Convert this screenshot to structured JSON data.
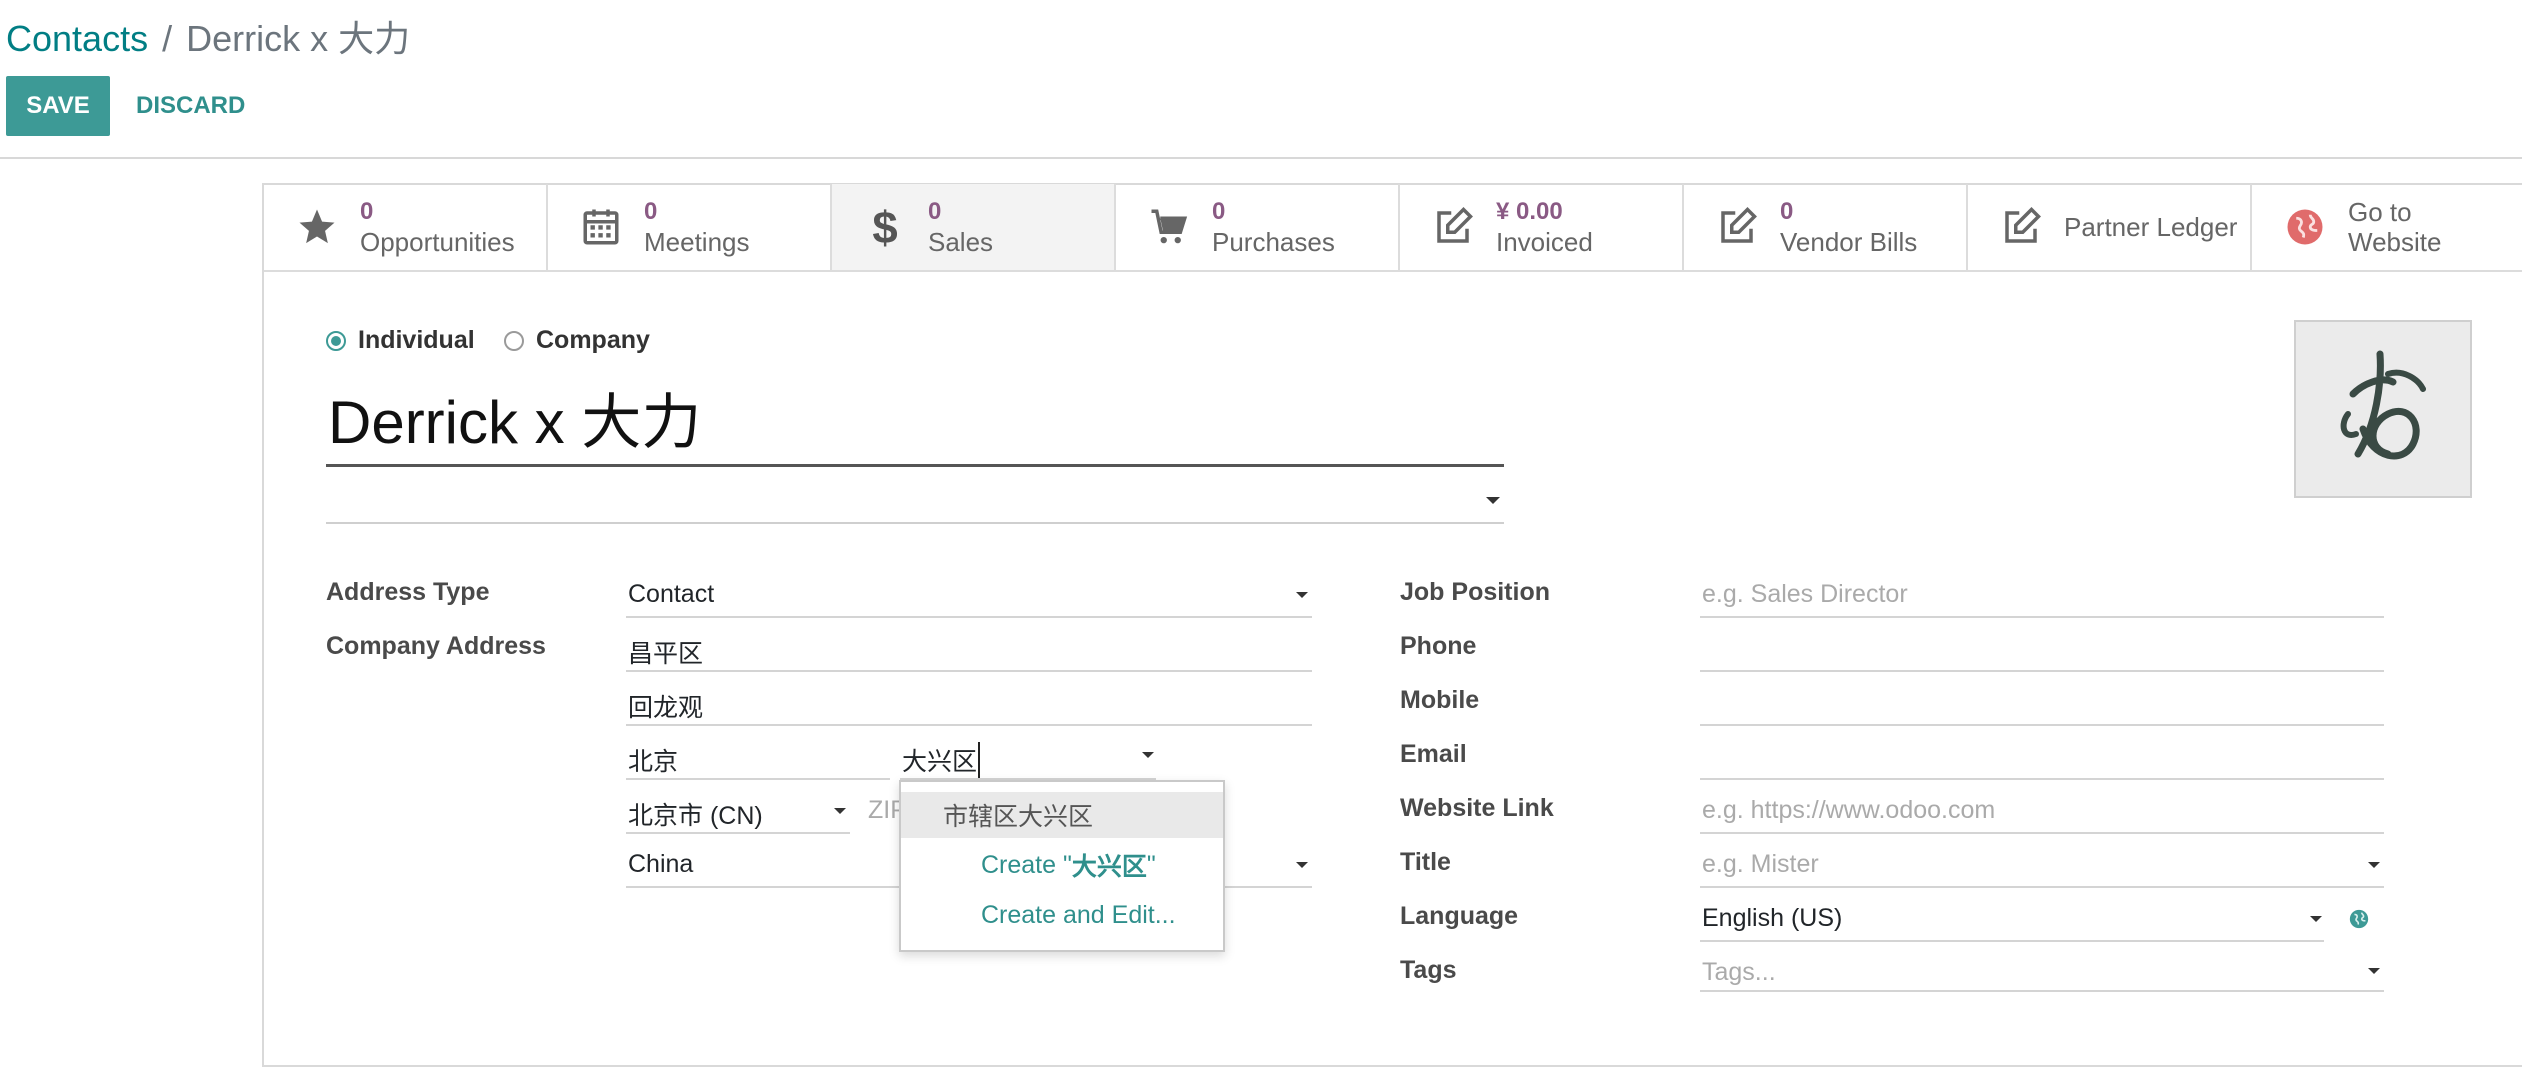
{
  "breadcrumb": {
    "root": "Contacts",
    "separator": "/",
    "current": "Derrick x 大力"
  },
  "actions": {
    "save": "SAVE",
    "discard": "DISCARD"
  },
  "smart_buttons": [
    {
      "value": "0",
      "label": "Opportunities",
      "icon": "star-icon"
    },
    {
      "value": "0",
      "label": "Meetings",
      "icon": "calendar-icon"
    },
    {
      "value": "0",
      "label": "Sales",
      "icon": "dollar-icon"
    },
    {
      "value": "0",
      "label": "Purchases",
      "icon": "cart-icon"
    },
    {
      "value": "¥ 0.00",
      "label": "Invoiced",
      "icon": "pencil-square-icon"
    },
    {
      "value": "0",
      "label": "Vendor Bills",
      "icon": "pencil-square-icon"
    },
    {
      "label": "Partner Ledger",
      "icon": "pencil-square-icon"
    },
    {
      "label": "Go to\nWebsite",
      "label_line1": "Go to",
      "label_line2": "Website",
      "icon": "globe-icon"
    }
  ],
  "company_type": {
    "individual": "Individual",
    "company": "Company",
    "selected": "individual"
  },
  "name": "Derrick x 大力",
  "left_fields": {
    "address_type_label": "Address Type",
    "address_type_value": "Contact",
    "company_address_label": "Company Address",
    "street": "昌平区",
    "street2": "回龙观",
    "city": "北京",
    "district": "大兴区",
    "state": "北京市 (CN)",
    "zip_placeholder": "ZIP",
    "country": "China"
  },
  "right_fields": {
    "job_position_label": "Job Position",
    "job_position_placeholder": "e.g. Sales Director",
    "phone_label": "Phone",
    "mobile_label": "Mobile",
    "email_label": "Email",
    "website_label": "Website Link",
    "website_placeholder": "e.g. https://www.odoo.com",
    "title_label": "Title",
    "title_placeholder": "e.g. Mister",
    "language_label": "Language",
    "language_value": "English (US)",
    "tags_label": "Tags",
    "tags_placeholder": "Tags..."
  },
  "autocomplete": {
    "items": [
      "市辖区大兴区"
    ],
    "create": "Create \"大兴区\"",
    "create_prefix": "Create \"",
    "create_term": "大兴区",
    "create_suffix": "\"",
    "create_edit": "Create and Edit..."
  },
  "colors": {
    "primary": "#3d9a96",
    "link": "#017e84",
    "smart_value": "#8a5a84"
  }
}
